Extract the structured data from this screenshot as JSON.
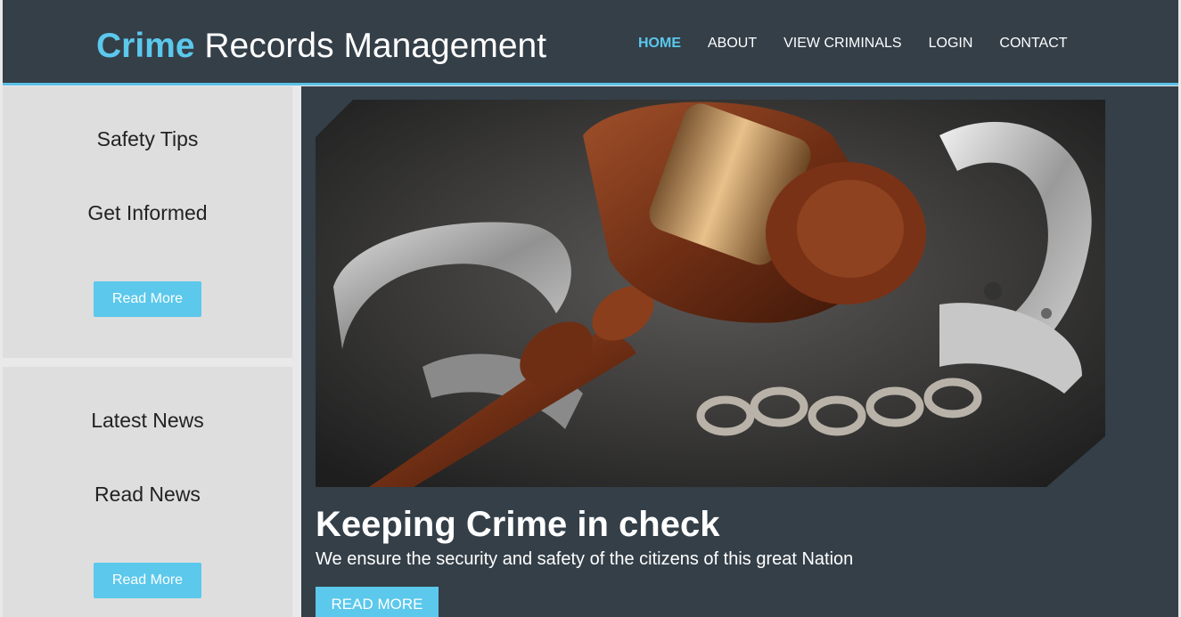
{
  "site": {
    "logo_accent": "Crime",
    "logo_rest": " Records Management"
  },
  "nav": {
    "items": [
      {
        "label": "HOME",
        "active": true
      },
      {
        "label": "ABOUT"
      },
      {
        "label": "VIEW CRIMINALS"
      },
      {
        "label": "LOGIN"
      },
      {
        "label": "CONTACT"
      }
    ]
  },
  "sidebar": {
    "box1": {
      "title": "Safety Tips",
      "subtitle": "Get Informed",
      "button": "Read More"
    },
    "box2": {
      "title": "Latest News",
      "subtitle": "Read News",
      "button": "Read More"
    }
  },
  "hero": {
    "title": "Keeping Crime in check",
    "subtitle": "We ensure the security and safety of the citizens of this great Nation",
    "button": "READ MORE"
  },
  "colors": {
    "header_bg": "#343f48",
    "accent": "#5bc8ec",
    "sidebar_bg": "#dedede"
  }
}
